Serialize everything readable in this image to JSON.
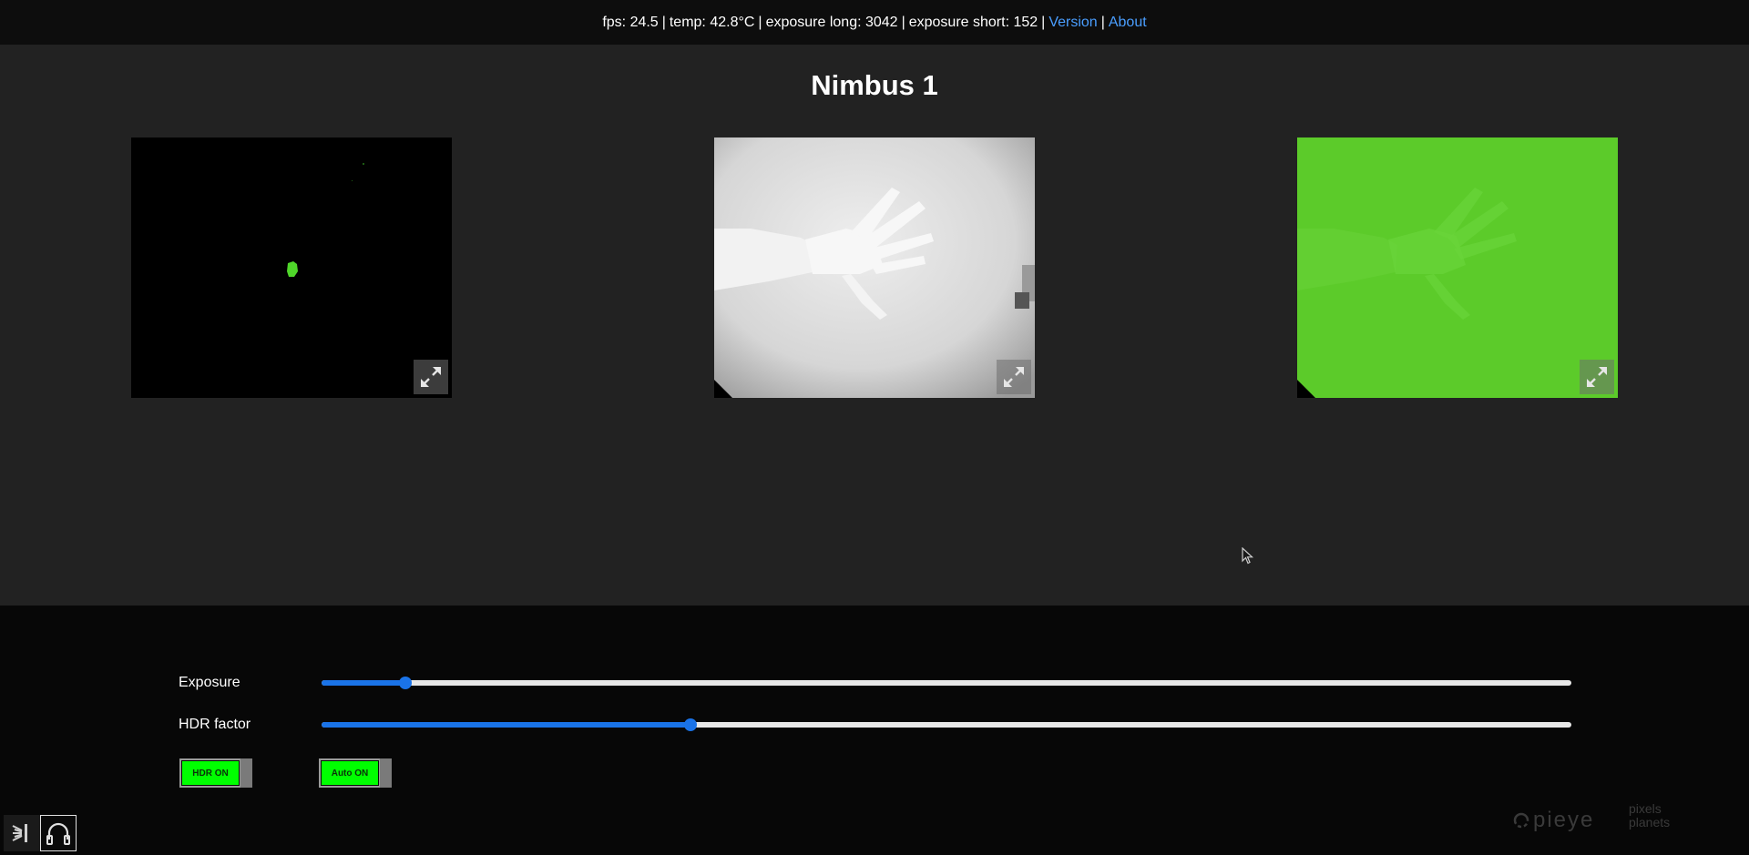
{
  "status": {
    "fps": "fps: 24.5",
    "temp": "temp: 42.8°C",
    "exposure_long": "exposure long: 3042",
    "exposure_short": "exposure short: 152",
    "separator": "|",
    "version_link": "Version",
    "about_link": "About"
  },
  "page": {
    "title": "Nimbus 1"
  },
  "feeds": [
    {
      "name": "mask-view",
      "background": "#000000",
      "accent": "#4fd62a"
    },
    {
      "name": "grayscale-camera-view",
      "background": "#dcdcdc"
    },
    {
      "name": "green-overlay-view",
      "background": "#5ccb2a"
    }
  ],
  "controls": {
    "exposure": {
      "label": "Exposure",
      "value_fraction": 0.067
    },
    "hdr_factor": {
      "label": "HDR factor",
      "value_fraction": 0.295
    },
    "hdr_toggle": {
      "label": "HDR ON"
    },
    "auto_toggle": {
      "label": "Auto ON"
    }
  },
  "branding": {
    "pieye": "pieye",
    "pixels_planets_line1": "pixels",
    "pixels_planets_line2": "planets"
  },
  "icons": {
    "expand": "expand-arrows-icon",
    "light": "light-rays-icon",
    "headphones": "headphones-icon"
  },
  "colors": {
    "accent_blue": "#1a73e8",
    "link_blue": "#4a9eff",
    "toggle_green": "#00ff00"
  }
}
